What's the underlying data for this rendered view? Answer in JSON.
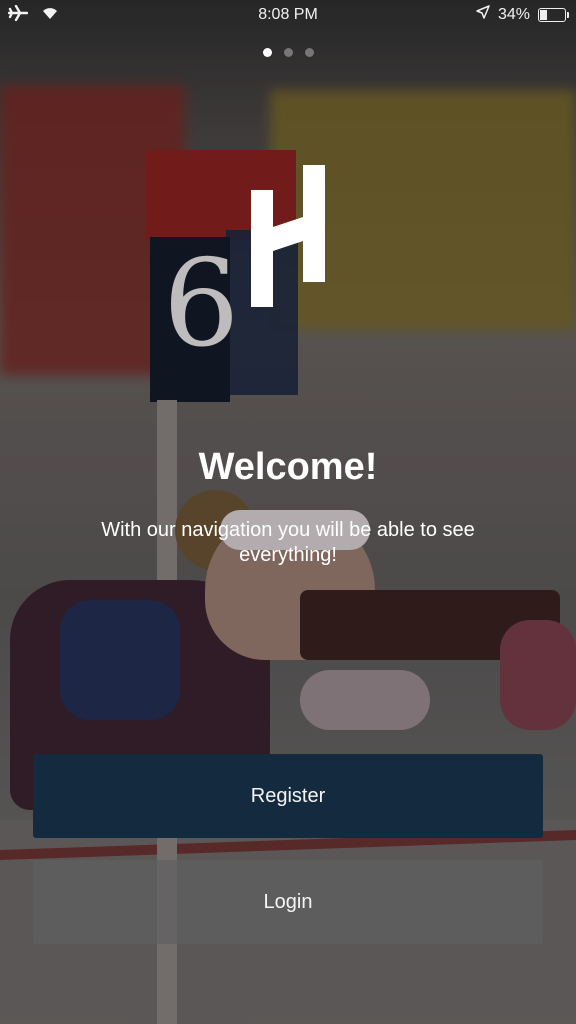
{
  "status_bar": {
    "time": "8:08 PM",
    "battery_percent": "34%",
    "battery_level": 0.34,
    "icons": [
      "airplane-icon",
      "wifi-icon",
      "location-arrow-icon",
      "battery-icon"
    ]
  },
  "carousel": {
    "page_count": 3,
    "active_index": 0
  },
  "logo": {
    "icon": "h-logo-icon",
    "color": "#ffffff"
  },
  "welcome": {
    "title": "Welcome!",
    "subtitle": "With our navigation you will be able to see everything!"
  },
  "actions": {
    "register_label": "Register",
    "login_label": "Login",
    "register_color": "#142a3e"
  }
}
